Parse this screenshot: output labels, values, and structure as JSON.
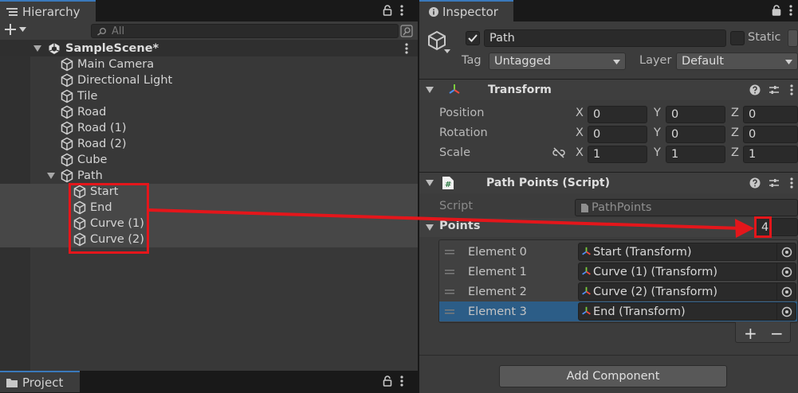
{
  "hierarchy": {
    "tab_label": "Hierarchy",
    "search_placeholder": "All",
    "scene_name": "SampleScene*",
    "items": [
      {
        "label": "Main Camera"
      },
      {
        "label": "Directional Light"
      },
      {
        "label": "Tile"
      },
      {
        "label": "Road"
      },
      {
        "label": "Road (1)"
      },
      {
        "label": "Road (2)"
      },
      {
        "label": "Cube"
      },
      {
        "label": "Path"
      }
    ],
    "path_children": [
      {
        "label": "Start"
      },
      {
        "label": "End"
      },
      {
        "label": "Curve (1)"
      },
      {
        "label": "Curve (2)"
      }
    ]
  },
  "project": {
    "tab_label": "Project"
  },
  "inspector": {
    "tab_label": "Inspector",
    "object_name": "Path",
    "static_label": "Static",
    "tag_label": "Tag",
    "tag_value": "Untagged",
    "layer_label": "Layer",
    "layer_value": "Default",
    "transform": {
      "title": "Transform",
      "position_label": "Position",
      "rotation_label": "Rotation",
      "scale_label": "Scale",
      "axis_x": "X",
      "axis_y": "Y",
      "axis_z": "Z",
      "position": {
        "x": "0",
        "y": "0",
        "z": "0"
      },
      "rotation": {
        "x": "0",
        "y": "0",
        "z": "0"
      },
      "scale": {
        "x": "1",
        "y": "1",
        "z": "1"
      }
    },
    "path_points": {
      "title": "Path Points (Script)",
      "script_label": "Script",
      "script_value": "PathPoints",
      "points_label": "Points",
      "points_count": "4",
      "elements": [
        {
          "label": "Element 0",
          "value": "Start (Transform)"
        },
        {
          "label": "Element 1",
          "value": "Curve (1) (Transform)"
        },
        {
          "label": "Element 2",
          "value": "Curve (2) (Transform)"
        },
        {
          "label": "Element 3",
          "value": "End (Transform)"
        }
      ],
      "add_symbol": "+",
      "remove_symbol": "−"
    },
    "add_component_label": "Add Component"
  },
  "annotation": {
    "color": "#e4161b"
  },
  "colors": {
    "selection": "#2c5d87",
    "accent_tab": "#3a79bb"
  }
}
